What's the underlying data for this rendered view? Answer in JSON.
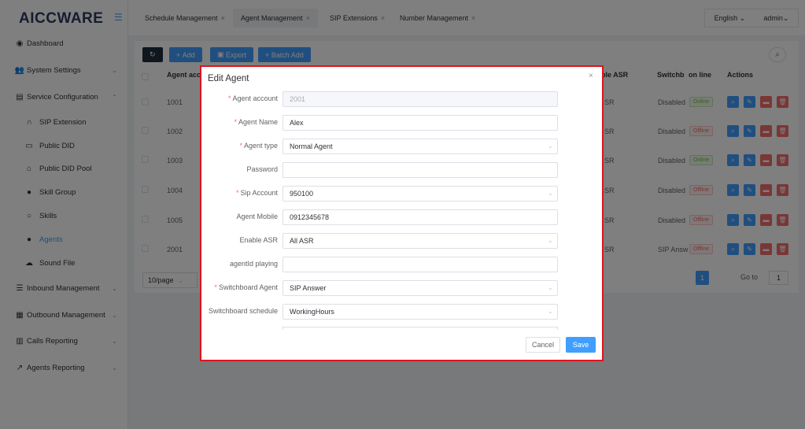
{
  "app": {
    "logo": "AICCWARE",
    "menu_toggle_icon": "menu-fold-icon"
  },
  "sidebar": {
    "items": [
      {
        "label": "Dashboard",
        "icon": "dashboard-icon",
        "chevron": ""
      },
      {
        "label": "System Settings",
        "icon": "users-icon",
        "chevron": "chevron-down-icon"
      },
      {
        "label": "Service Configuration",
        "icon": "id-card-icon",
        "chevron": "chevron-up-icon"
      },
      {
        "label": "SIP Extension",
        "icon": "headset-icon"
      },
      {
        "label": "Public DID",
        "icon": "folder-icon"
      },
      {
        "label": "Public DID Pool",
        "icon": "home-icon"
      },
      {
        "label": "Skill Group",
        "icon": "user-icon"
      },
      {
        "label": "Skills",
        "icon": "person-icon"
      },
      {
        "label": "Agents",
        "icon": "user-icon"
      },
      {
        "label": "Sound File",
        "icon": "cloud-icon"
      },
      {
        "label": "Inbound Management",
        "icon": "list-icon",
        "chevron": "chevron-down-icon"
      },
      {
        "label": "Outbound Management",
        "icon": "table-icon",
        "chevron": "chevron-down-icon"
      },
      {
        "label": "Calls Reporting",
        "icon": "bar-chart-icon",
        "chevron": "chevron-down-icon"
      },
      {
        "label": "Agents Reporting",
        "icon": "line-chart-icon",
        "chevron": "chevron-down-icon"
      }
    ]
  },
  "tabs": [
    {
      "label": "Schedule Management",
      "close": "×"
    },
    {
      "label": "Agent Management",
      "close": "×"
    },
    {
      "label": "SIP Extensions",
      "close": "×"
    },
    {
      "label": "Number Management",
      "close": "×"
    }
  ],
  "header": {
    "language": "English",
    "user": "admin"
  },
  "toolbar": {
    "add": "Add",
    "export": "Export",
    "batch_add": "Batch Add"
  },
  "table": {
    "headers": {
      "agent_account": "Agent acc",
      "enable_asr": "ble ASR",
      "switchboard": "Switchb",
      "online": "on line",
      "actions": "Actions"
    },
    "rows": [
      {
        "account": "1001",
        "asr": "SR",
        "switch": "Disabled",
        "status": "Online"
      },
      {
        "account": "1002",
        "asr": "SR",
        "switch": "Disabled",
        "status": "Offline"
      },
      {
        "account": "1003",
        "asr": "SR",
        "switch": "Disabled",
        "status": "Online"
      },
      {
        "account": "1004",
        "asr": "SR",
        "switch": "Disabled",
        "status": "Offline"
      },
      {
        "account": "1005",
        "asr": "SR",
        "switch": "Disabled",
        "status": "Offline"
      },
      {
        "account": "2001",
        "asr": "SR",
        "switch": "SIP Answ",
        "status": "Offline"
      }
    ]
  },
  "pager": {
    "size": "10/page",
    "current": "1",
    "goto_label": "Go to",
    "goto_value": "1"
  },
  "dialog": {
    "title": "Edit Agent",
    "fields": [
      {
        "label": "Agent account",
        "value": "2001",
        "required": true
      },
      {
        "label": "Agent Name",
        "value": "Alex",
        "required": true
      },
      {
        "label": "Agent type",
        "value": "Normal Agent",
        "required": true
      },
      {
        "label": "Password",
        "value": "",
        "required": false
      },
      {
        "label": "Sip Account",
        "value": "950100",
        "required": true
      },
      {
        "label": "Agent Mobile",
        "value": "0912345678",
        "required": false
      },
      {
        "label": "Enable ASR",
        "value": "All ASR",
        "required": false
      },
      {
        "label": "agentId playing",
        "value": "",
        "required": false
      },
      {
        "label": "Switchboard Agent",
        "value": "SIP Answer",
        "required": true
      },
      {
        "label": "Switchboard schedule",
        "value": "WorkingHours",
        "required": false
      }
    ],
    "cancel": "Cancel",
    "save": "Save"
  },
  "colors": {
    "primary": "#409eff",
    "danger": "#f56c6c",
    "success": "#67c23a",
    "highlight_border": "#e0141e"
  }
}
